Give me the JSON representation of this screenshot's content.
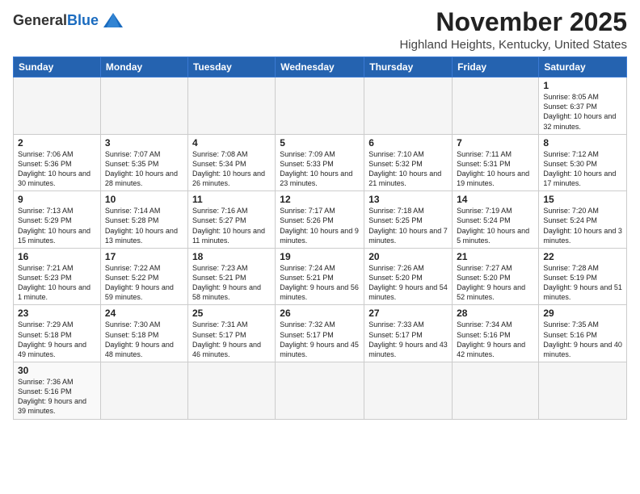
{
  "header": {
    "logo_general": "General",
    "logo_blue": "Blue",
    "month_year": "November 2025",
    "location": "Highland Heights, Kentucky, United States"
  },
  "days_of_week": [
    "Sunday",
    "Monday",
    "Tuesday",
    "Wednesday",
    "Thursday",
    "Friday",
    "Saturday"
  ],
  "weeks": [
    [
      {
        "day": "",
        "info": ""
      },
      {
        "day": "",
        "info": ""
      },
      {
        "day": "",
        "info": ""
      },
      {
        "day": "",
        "info": ""
      },
      {
        "day": "",
        "info": ""
      },
      {
        "day": "",
        "info": ""
      },
      {
        "day": "1",
        "info": "Sunrise: 8:05 AM\nSunset: 6:37 PM\nDaylight: 10 hours and 32 minutes."
      }
    ],
    [
      {
        "day": "2",
        "info": "Sunrise: 7:06 AM\nSunset: 5:36 PM\nDaylight: 10 hours and 30 minutes."
      },
      {
        "day": "3",
        "info": "Sunrise: 7:07 AM\nSunset: 5:35 PM\nDaylight: 10 hours and 28 minutes."
      },
      {
        "day": "4",
        "info": "Sunrise: 7:08 AM\nSunset: 5:34 PM\nDaylight: 10 hours and 26 minutes."
      },
      {
        "day": "5",
        "info": "Sunrise: 7:09 AM\nSunset: 5:33 PM\nDaylight: 10 hours and 23 minutes."
      },
      {
        "day": "6",
        "info": "Sunrise: 7:10 AM\nSunset: 5:32 PM\nDaylight: 10 hours and 21 minutes."
      },
      {
        "day": "7",
        "info": "Sunrise: 7:11 AM\nSunset: 5:31 PM\nDaylight: 10 hours and 19 minutes."
      },
      {
        "day": "8",
        "info": "Sunrise: 7:12 AM\nSunset: 5:30 PM\nDaylight: 10 hours and 17 minutes."
      }
    ],
    [
      {
        "day": "9",
        "info": "Sunrise: 7:13 AM\nSunset: 5:29 PM\nDaylight: 10 hours and 15 minutes."
      },
      {
        "day": "10",
        "info": "Sunrise: 7:14 AM\nSunset: 5:28 PM\nDaylight: 10 hours and 13 minutes."
      },
      {
        "day": "11",
        "info": "Sunrise: 7:16 AM\nSunset: 5:27 PM\nDaylight: 10 hours and 11 minutes."
      },
      {
        "day": "12",
        "info": "Sunrise: 7:17 AM\nSunset: 5:26 PM\nDaylight: 10 hours and 9 minutes."
      },
      {
        "day": "13",
        "info": "Sunrise: 7:18 AM\nSunset: 5:25 PM\nDaylight: 10 hours and 7 minutes."
      },
      {
        "day": "14",
        "info": "Sunrise: 7:19 AM\nSunset: 5:24 PM\nDaylight: 10 hours and 5 minutes."
      },
      {
        "day": "15",
        "info": "Sunrise: 7:20 AM\nSunset: 5:24 PM\nDaylight: 10 hours and 3 minutes."
      }
    ],
    [
      {
        "day": "16",
        "info": "Sunrise: 7:21 AM\nSunset: 5:23 PM\nDaylight: 10 hours and 1 minute."
      },
      {
        "day": "17",
        "info": "Sunrise: 7:22 AM\nSunset: 5:22 PM\nDaylight: 9 hours and 59 minutes."
      },
      {
        "day": "18",
        "info": "Sunrise: 7:23 AM\nSunset: 5:21 PM\nDaylight: 9 hours and 58 minutes."
      },
      {
        "day": "19",
        "info": "Sunrise: 7:24 AM\nSunset: 5:21 PM\nDaylight: 9 hours and 56 minutes."
      },
      {
        "day": "20",
        "info": "Sunrise: 7:26 AM\nSunset: 5:20 PM\nDaylight: 9 hours and 54 minutes."
      },
      {
        "day": "21",
        "info": "Sunrise: 7:27 AM\nSunset: 5:20 PM\nDaylight: 9 hours and 52 minutes."
      },
      {
        "day": "22",
        "info": "Sunrise: 7:28 AM\nSunset: 5:19 PM\nDaylight: 9 hours and 51 minutes."
      }
    ],
    [
      {
        "day": "23",
        "info": "Sunrise: 7:29 AM\nSunset: 5:18 PM\nDaylight: 9 hours and 49 minutes."
      },
      {
        "day": "24",
        "info": "Sunrise: 7:30 AM\nSunset: 5:18 PM\nDaylight: 9 hours and 48 minutes."
      },
      {
        "day": "25",
        "info": "Sunrise: 7:31 AM\nSunset: 5:17 PM\nDaylight: 9 hours and 46 minutes."
      },
      {
        "day": "26",
        "info": "Sunrise: 7:32 AM\nSunset: 5:17 PM\nDaylight: 9 hours and 45 minutes."
      },
      {
        "day": "27",
        "info": "Sunrise: 7:33 AM\nSunset: 5:17 PM\nDaylight: 9 hours and 43 minutes."
      },
      {
        "day": "28",
        "info": "Sunrise: 7:34 AM\nSunset: 5:16 PM\nDaylight: 9 hours and 42 minutes."
      },
      {
        "day": "29",
        "info": "Sunrise: 7:35 AM\nSunset: 5:16 PM\nDaylight: 9 hours and 40 minutes."
      }
    ],
    [
      {
        "day": "30",
        "info": "Sunrise: 7:36 AM\nSunset: 5:16 PM\nDaylight: 9 hours and 39 minutes."
      },
      {
        "day": "",
        "info": ""
      },
      {
        "day": "",
        "info": ""
      },
      {
        "day": "",
        "info": ""
      },
      {
        "day": "",
        "info": ""
      },
      {
        "day": "",
        "info": ""
      },
      {
        "day": "",
        "info": ""
      }
    ]
  ]
}
